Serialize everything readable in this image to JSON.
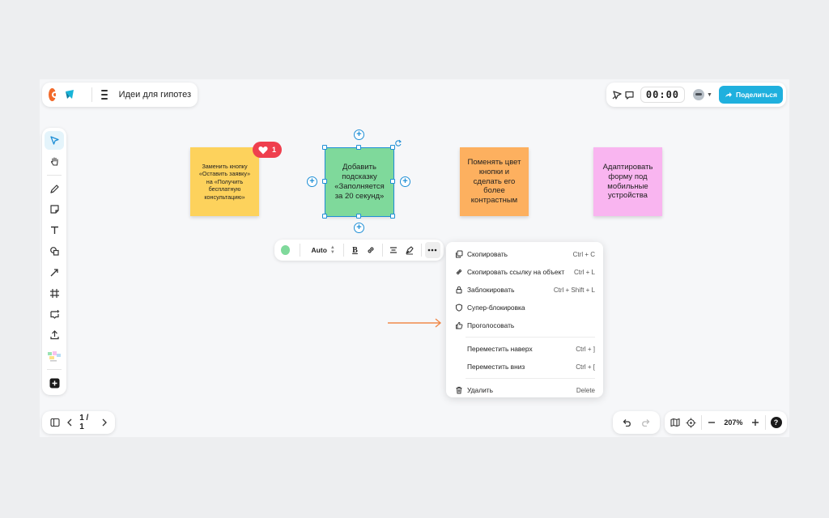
{
  "header": {
    "logo1_icon": "yandex-logo-icon",
    "logo2_icon": "board-app-icon",
    "board_title": "Идеи для гипотез",
    "timer": "00:00",
    "share_label": "Поделиться"
  },
  "stickies": [
    {
      "text": "Заменить кнопку «Оставить заявку» на «Получить бесплатную консультацию»",
      "color": "#fdd25c"
    },
    {
      "text": "Добавить подсказку «Заполняется за 20 секунд»",
      "color": "#7fd99b"
    },
    {
      "text": "Поменять цвет кнопки и сделать его более контрастным",
      "color": "#fdb05f"
    },
    {
      "text": "Адаптировать форму под мобильные устройства",
      "color": "#f9b5f0"
    }
  ],
  "reaction": {
    "count": "1",
    "icon": "heart-icon",
    "color": "#ef3f4e"
  },
  "format_toolbar": {
    "font_size": "Auto",
    "color": "#7fd99b"
  },
  "context_menu": [
    {
      "label": "Скопировать",
      "shortcut": "Ctrl + C",
      "icon": "copy-icon"
    },
    {
      "label": "Скопировать ссылку на объект",
      "shortcut": "Ctrl + L",
      "icon": "link-icon"
    },
    {
      "label": "Заблокировать",
      "shortcut": "Ctrl + Shift + L",
      "icon": "lock-icon"
    },
    {
      "label": "Супер-блокировка",
      "shortcut": "",
      "icon": "shield-icon"
    },
    {
      "label": "Проголосовать",
      "shortcut": "",
      "icon": "thumbs-up-icon"
    },
    {
      "label": "Переместить наверх",
      "shortcut": "Ctrl + ]",
      "icon": ""
    },
    {
      "label": "Переместить вниз",
      "shortcut": "Ctrl + [",
      "icon": ""
    },
    {
      "label": "Удалить",
      "shortcut": "Delete",
      "icon": "trash-icon"
    }
  ],
  "pagination": {
    "label": "1 / 1"
  },
  "zoom": {
    "level": "207%"
  },
  "help_label": "?",
  "colors": {
    "accent": "#1fb0de",
    "selection": "#1f8fd6",
    "arrow": "#f08a4b"
  }
}
